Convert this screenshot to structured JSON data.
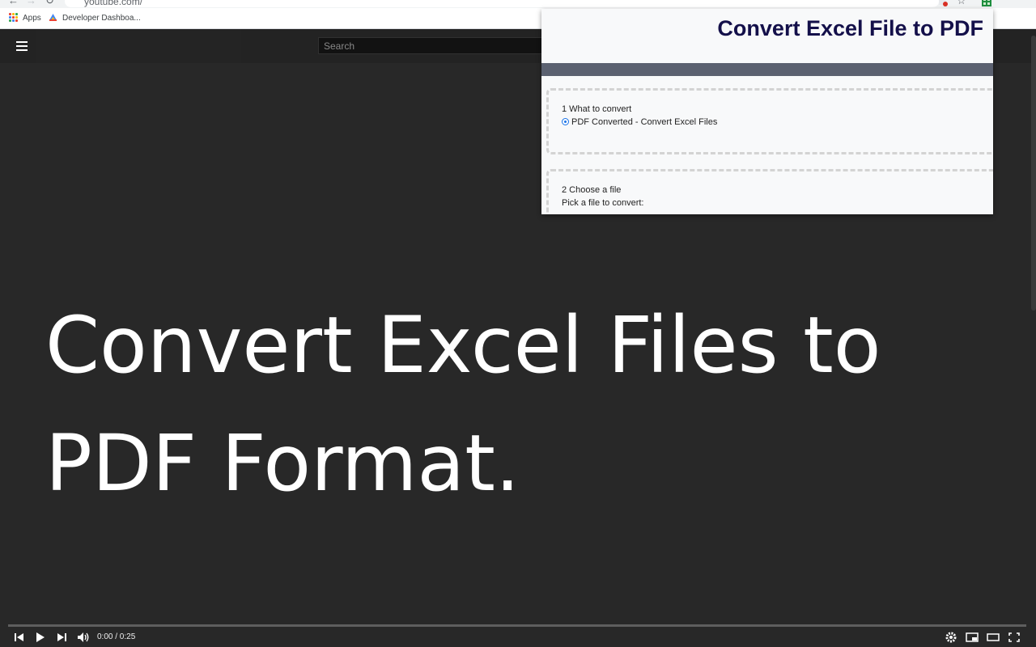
{
  "browser": {
    "url": "youtube.com/",
    "bookmarks": [
      {
        "label": "Apps"
      },
      {
        "label": "Developer Dashboa..."
      }
    ],
    "apps_dot_colors": [
      "#ea4335",
      "#fbbc05",
      "#34a853",
      "#4285f4",
      "#ea4335",
      "#fbbc05",
      "#34a853",
      "#4285f4",
      "#ea4335"
    ]
  },
  "youtube": {
    "search_placeholder": "Search",
    "video_title_line1": "Convert Excel Files to",
    "video_title_line2": "PDF Format.",
    "player": {
      "time": "0:00 / 0:25",
      "progress_fraction": 0
    }
  },
  "popup": {
    "title": "Convert Excel File to PDF",
    "step1": {
      "heading": "1 What to convert",
      "option_label": "PDF Converted - Convert Excel Files",
      "option_selected": true
    },
    "step2": {
      "heading": "2 Choose a file",
      "prompt": "Pick a file to convert:"
    }
  },
  "colors": {
    "popup_title": "#14104a",
    "popup_bar": "#5b6170",
    "video_bg": "#282828"
  }
}
